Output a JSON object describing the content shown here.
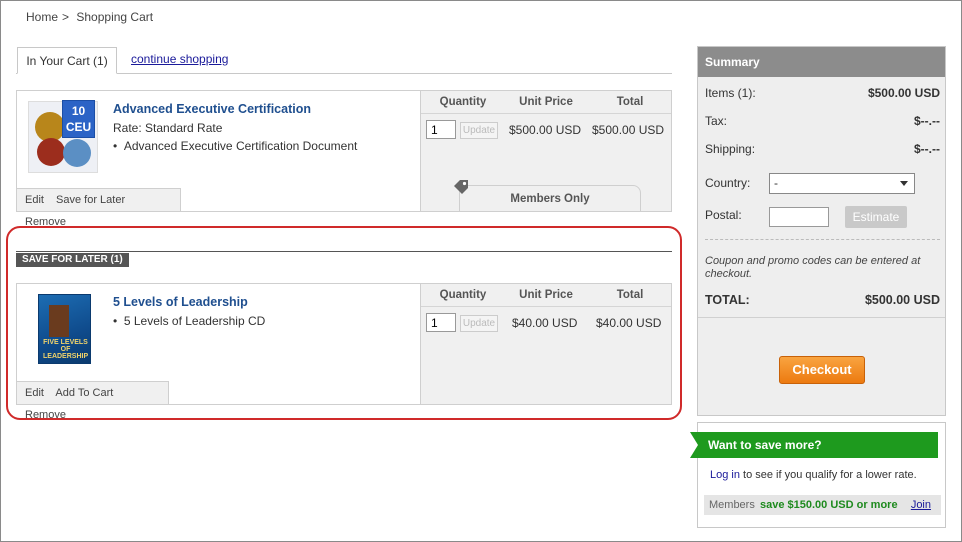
{
  "breadcrumb": {
    "home": "Home",
    "sep": ">",
    "current": "Shopping Cart"
  },
  "tabs": {
    "active": "In Your Cart (1)",
    "link": "continue shopping"
  },
  "columns": {
    "quantity": "Quantity",
    "unit_price": "Unit Price",
    "total": "Total"
  },
  "cart_item": {
    "ceu_number": "10",
    "ceu_label": "CEU",
    "title": "Advanced Executive Certification",
    "rate": "Rate: Standard Rate",
    "bullet": "Advanced Executive Certification Document",
    "qty": "1",
    "update": "Update",
    "unit_price": "$500.00 USD",
    "total": "$500.00 USD",
    "actions": [
      "Edit",
      "Save for Later",
      "Remove"
    ],
    "members_tab": "Members Only"
  },
  "save_for_later": {
    "label": "SAVE FOR LATER (1)",
    "item": {
      "book_text": "FIVE LEVELS OF LEADERSHIP",
      "title": "5 Levels of Leadership",
      "bullet": "5 Levels of Leadership CD",
      "qty": "1",
      "update": "Update",
      "unit_price": "$40.00 USD",
      "total": "$40.00 USD",
      "actions": [
        "Edit",
        "Add To Cart",
        "Remove"
      ]
    }
  },
  "summary": {
    "title": "Summary",
    "items_label": "Items (1):",
    "items_value": "$500.00 USD",
    "tax_label": "Tax:",
    "tax_value": "$--.--",
    "shipping_label": "Shipping:",
    "shipping_value": "$--.--",
    "country_label": "Country:",
    "country_value": "-",
    "postal_label": "Postal:",
    "estimate": "Estimate",
    "coupon_note": "Coupon and promo codes can be entered at checkout.",
    "total_label": "TOTAL:",
    "total_value": "$500.00 USD",
    "checkout": "Checkout"
  },
  "save_more": {
    "banner": "Want to save more?",
    "login_link": "Log in",
    "login_text": " to see if you qualify for a lower rate.",
    "members_label": "Members",
    "members_amount": "save $150.00 USD or more",
    "join": "Join"
  },
  "colors": {
    "accent_green": "#1e9a1e",
    "checkout_orange": "#ec7a10",
    "highlight_red": "#d02a2a",
    "link_blue": "#1f4f8f"
  }
}
